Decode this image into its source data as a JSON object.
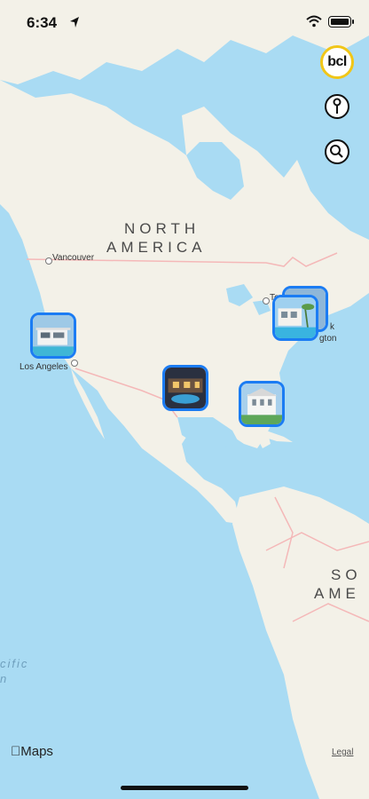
{
  "status_bar": {
    "time": "6:34"
  },
  "brand": {
    "logo_text": "bcl"
  },
  "controls": {
    "info_icon": "pin-info-icon",
    "search_icon": "search-icon"
  },
  "map": {
    "regions": {
      "north_line1": "NORTH",
      "north_line2": "AMERICA",
      "south_line1": "SO",
      "south_line2": "AME"
    },
    "cities": {
      "vancouver": "Vancouver",
      "los_angeles": "Los Angeles",
      "toronto": "To",
      "new_york_partial": "k",
      "washington_partial": "gton"
    },
    "ocean": {
      "line1": "cific",
      "line2": "n"
    },
    "colors": {
      "water": "#a9dbf3",
      "land": "#f3f1e8",
      "pin_border": "#1b7cf3",
      "border_line": "#f4b8b8"
    }
  },
  "pins": [
    {
      "name": "listing-los-angeles"
    },
    {
      "name": "listing-houston"
    },
    {
      "name": "listing-miami"
    },
    {
      "name": "listing-new-york"
    }
  ],
  "footer": {
    "maps_label": "Maps",
    "legal_label": "Legal"
  }
}
